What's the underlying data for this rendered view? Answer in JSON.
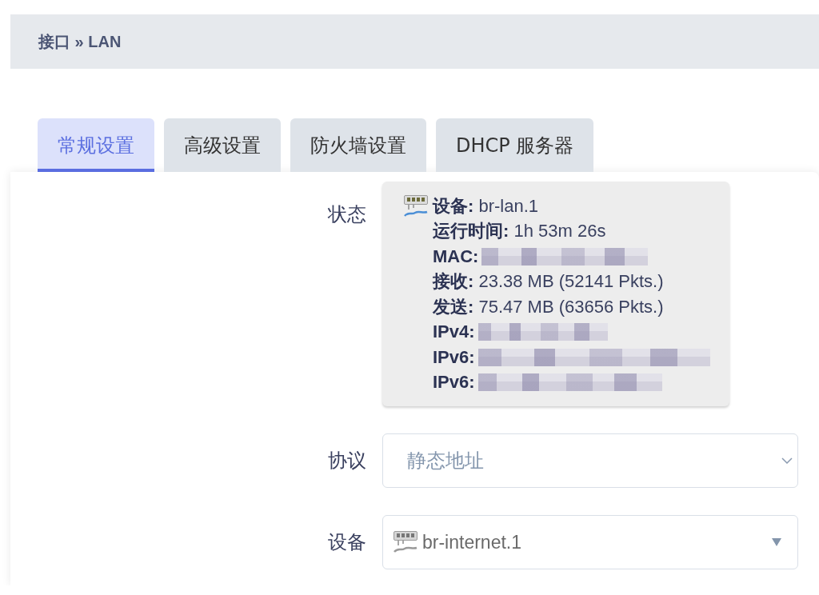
{
  "header": {
    "title": "接口 » LAN"
  },
  "tabs": [
    {
      "label": "常规设置",
      "selected": true
    },
    {
      "label": "高级设置",
      "selected": false
    },
    {
      "label": "防火墙设置",
      "selected": false
    },
    {
      "label": "DHCP 服务器",
      "selected": false
    }
  ],
  "form": {
    "status": {
      "label": "状态",
      "lines": [
        {
          "label": "设备:",
          "value": "br-lan.1",
          "redacted": false
        },
        {
          "label": "运行时间:",
          "value": "1h 53m 26s",
          "redacted": false
        },
        {
          "label": "MAC:",
          "redacted": true
        },
        {
          "label": "接收:",
          "value": "23.38 MB (52141 Pkts.)",
          "redacted": false
        },
        {
          "label": "发送:",
          "value": "75.47 MB (63656 Pkts.)",
          "redacted": false
        },
        {
          "label": "IPv4:",
          "redacted": true
        },
        {
          "label": "IPv6:",
          "redacted": true
        },
        {
          "label": "IPv6:",
          "redacted": true
        }
      ]
    },
    "fields": [
      {
        "label": "协议",
        "kind": "select",
        "value": "静态地址"
      },
      {
        "label": "设备",
        "kind": "device_select",
        "value": "br-internet.1"
      }
    ]
  }
}
